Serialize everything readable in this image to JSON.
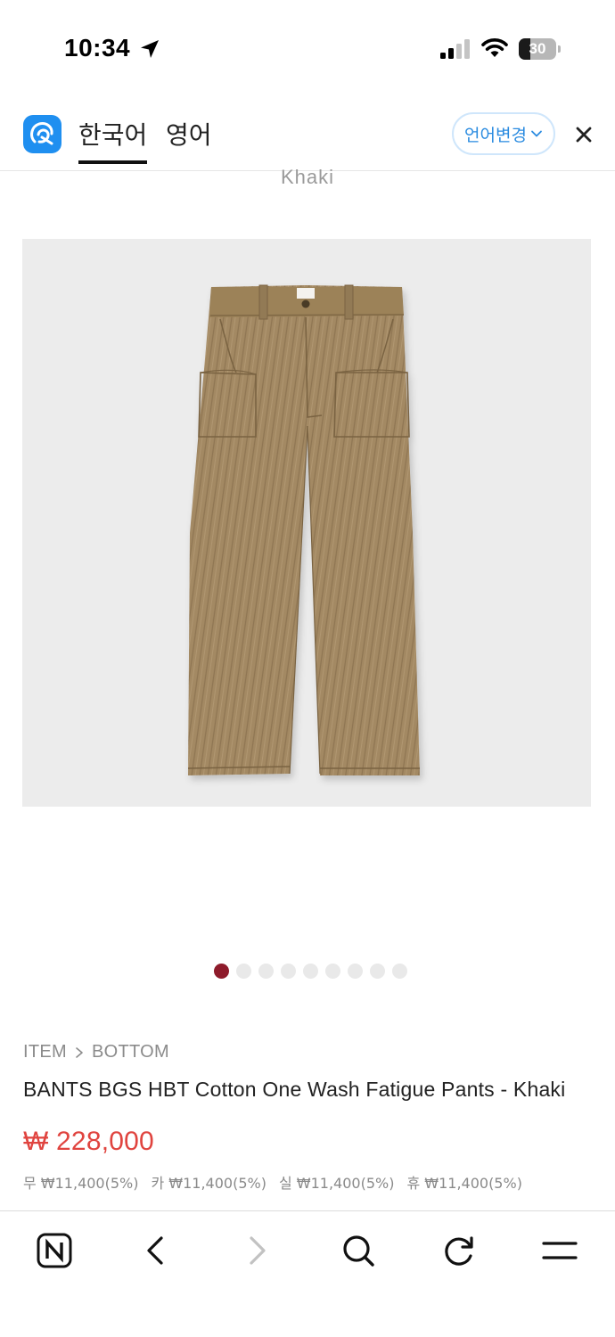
{
  "status": {
    "time": "10:34",
    "battery": "30",
    "battery_level": 0.3
  },
  "translate_bar": {
    "tab_korean": "한국어",
    "tab_english": "영어",
    "change_language": "언어변경"
  },
  "product": {
    "color_label": "Khaki",
    "image_count": 9,
    "active_image_index": 0,
    "breadcrumb": [
      "ITEM",
      "BOTTOM"
    ],
    "name": "BANTS BGS HBT Cotton One Wash Fatigue Pants - Khaki",
    "price": "₩ 228,000",
    "point_rewards": [
      "무 ₩11,400(5%)",
      "카 ₩11,400(5%)",
      "실 ₩11,400(5%)",
      "휴 ₩11,400(5%)"
    ]
  },
  "icons": {
    "status": [
      "location-arrow-icon",
      "signal-icon",
      "wifi-icon",
      "battery-icon"
    ],
    "translate_bar": [
      "translator-logo-icon",
      "chevron-down-icon",
      "close-icon"
    ],
    "toolbar": [
      "naver-home-icon",
      "back-icon",
      "forward-icon",
      "search-icon",
      "refresh-icon",
      "menu-icon"
    ]
  },
  "colors": {
    "accent_blue": "#2a8be0",
    "price_red": "#e0443f",
    "active_dot": "#8e1b2b",
    "product_khaki": "#a38963"
  }
}
